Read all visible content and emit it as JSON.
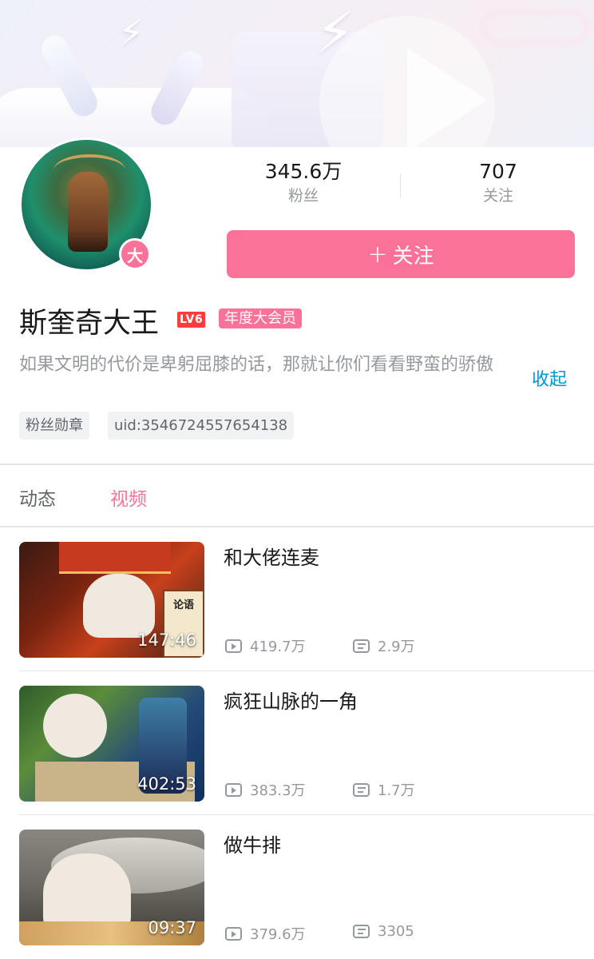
{
  "profile": {
    "fans_count": "345.6万",
    "fans_label": "粉丝",
    "following_count": "707",
    "following_label": "关注",
    "follow_button_label": "关注",
    "avatar_badge": "大",
    "name": "斯奎奇大王",
    "level_badge": "LV6",
    "vip_badge": "年度大会员",
    "signature": "如果文明的代价是卑躬屈膝的话，那就让你们看看野蛮的骄傲",
    "collapse_label": "收起",
    "tags": {
      "medal": "粉丝勋章",
      "uid": "uid:3546724557654138"
    }
  },
  "tabs": {
    "dynamic": "动态",
    "video": "视频",
    "active": "video"
  },
  "videos": [
    {
      "title": "和大佬连麦",
      "duration": "147:46",
      "plays": "419.7万",
      "danmaku": "2.9万",
      "thumb_text": "论语"
    },
    {
      "title": "疯狂山脉的一角",
      "duration": "402:53",
      "plays": "383.3万",
      "danmaku": "1.7万"
    },
    {
      "title": "做牛排",
      "duration": "09:37",
      "plays": "379.6万",
      "danmaku": "3305"
    }
  ],
  "colors": {
    "brand_pink": "#fb7299",
    "link_blue": "#0096d8",
    "level_red": "#ff3b3b"
  },
  "icons": {
    "play": "play-count-icon",
    "danmaku": "danmaku-count-icon",
    "plus": "plus-icon"
  }
}
